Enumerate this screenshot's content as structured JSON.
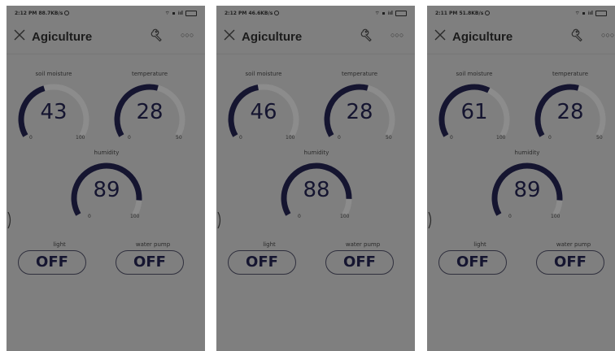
{
  "colors": {
    "screen": "#7f7f7f",
    "arc_fill": "#151530",
    "arc_track": "#8c8c8c",
    "text": "#1c1c1c"
  },
  "icons": {
    "close": "close-icon",
    "settings": "wrench-icon",
    "more": "more-icon"
  },
  "screens": [
    {
      "status": {
        "time_speed": "2:12 PM  88.7KB/s"
      },
      "title": "Agiculture",
      "gauges": {
        "soil_moisture": {
          "label": "soil moisture",
          "value": "43",
          "min": "0",
          "max": "100",
          "level": 0.43
        },
        "temperature": {
          "label": "temperature",
          "value": "28",
          "min": "0",
          "max": "50",
          "level": 0.56
        },
        "humidity": {
          "label": "humidity",
          "value": "89",
          "min": "0",
          "max": "100",
          "level": 0.89
        }
      },
      "switches": {
        "light": {
          "label": "light",
          "state": "OFF"
        },
        "water_pump": {
          "label": "water pump",
          "state": "OFF"
        }
      }
    },
    {
      "status": {
        "time_speed": "2:12 PM  46.6KB/s"
      },
      "title": "Agiculture",
      "gauges": {
        "soil_moisture": {
          "label": "soil moisture",
          "value": "46",
          "min": "0",
          "max": "100",
          "level": 0.46
        },
        "temperature": {
          "label": "temperature",
          "value": "28",
          "min": "0",
          "max": "50",
          "level": 0.56
        },
        "humidity": {
          "label": "humidity",
          "value": "88",
          "min": "0",
          "max": "100",
          "level": 0.88
        }
      },
      "switches": {
        "light": {
          "label": "light",
          "state": "OFF"
        },
        "water_pump": {
          "label": "water pump",
          "state": "OFF"
        }
      }
    },
    {
      "status": {
        "time_speed": "2:11 PM  51.8KB/s"
      },
      "title": "Agiculture",
      "gauges": {
        "soil_moisture": {
          "label": "soil moisture",
          "value": "61",
          "min": "0",
          "max": "100",
          "level": 0.61
        },
        "temperature": {
          "label": "temperature",
          "value": "28",
          "min": "0",
          "max": "50",
          "level": 0.56
        },
        "humidity": {
          "label": "humidity",
          "value": "89",
          "min": "0",
          "max": "100",
          "level": 0.89
        }
      },
      "switches": {
        "light": {
          "label": "light",
          "state": "OFF"
        },
        "water_pump": {
          "label": "water pump",
          "state": "OFF"
        }
      }
    }
  ]
}
